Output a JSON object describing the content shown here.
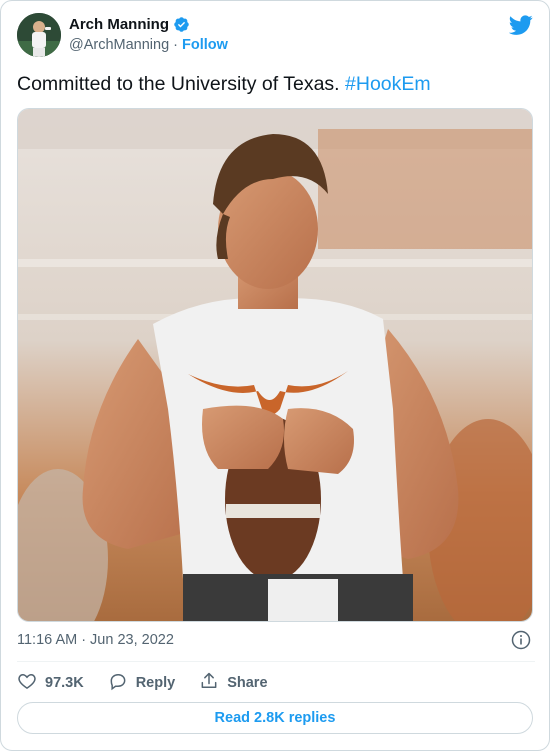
{
  "tweet": {
    "author": {
      "display_name": "Arch Manning",
      "handle": "@ArchManning",
      "separator": "·",
      "follow_label": "Follow",
      "verified": true,
      "avatar_icon": "profile-photo"
    },
    "text": "Committed to the University of Texas.",
    "hashtag": "#HookEm",
    "timestamp": {
      "time": "11:16 AM",
      "separator": "·",
      "date": "Jun 23, 2022"
    },
    "actions": {
      "like_count": "97.3K",
      "reply_label": "Reply",
      "share_label": "Share"
    },
    "read_replies_label": "Read 2.8K replies"
  },
  "colors": {
    "link_blue": "#1d9bf0",
    "secondary_text": "#536471",
    "border": "#cfd9de",
    "like_red": "#f91880"
  },
  "icons": {
    "brand": "twitter-bird-icon",
    "verified": "verified-badge-icon",
    "info": "info-icon",
    "like": "heart-icon",
    "reply": "speech-bubble-icon",
    "share": "share-upload-icon"
  }
}
